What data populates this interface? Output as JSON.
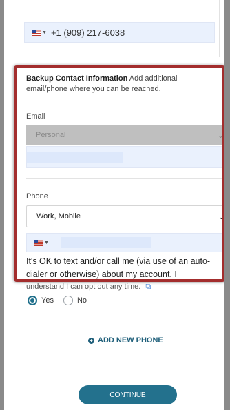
{
  "primary_contact": {
    "phone_value": "+1 (909) 217-6038",
    "country_flag_icon": "us-flag-icon"
  },
  "backup": {
    "title": "Backup Contact Information",
    "subtitle": "Add additional email/phone where you can be reached.",
    "email_label": "Email",
    "email_type_value": "Personal",
    "phone_label": "Phone",
    "phone_type_value": "Work, Mobile",
    "consent_text": "It's OK to text and/or call me (via use of an auto-dialer or otherwise) about my account. I",
    "consent_overflow_text": "understand I can opt out any time."
  },
  "consent_options": {
    "yes_label": "Yes",
    "no_label": "No",
    "selected": "Yes"
  },
  "actions": {
    "add_phone_label": "ADD NEW PHONE",
    "continue_label": "CONTINUE"
  },
  "colors": {
    "highlight_border": "#a32d2d",
    "primary_button": "#23718d",
    "input_background": "#eaf1fd"
  }
}
